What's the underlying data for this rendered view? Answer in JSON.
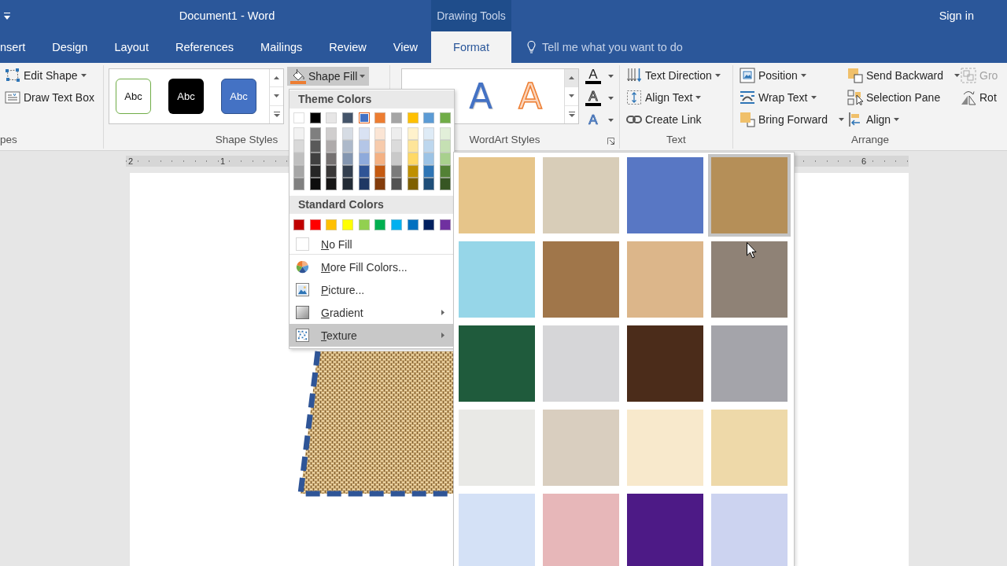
{
  "title_bar": {
    "title": "Document1 - Word",
    "context_header": "Drawing Tools",
    "sign_in": "Sign in"
  },
  "tabs": [
    {
      "label": "nsert",
      "contextual": false,
      "selected": false
    },
    {
      "label": "Design",
      "contextual": false,
      "selected": false
    },
    {
      "label": "Layout",
      "contextual": false,
      "selected": false
    },
    {
      "label": "References",
      "contextual": false,
      "selected": false
    },
    {
      "label": "Mailings",
      "contextual": false,
      "selected": false
    },
    {
      "label": "Review",
      "contextual": false,
      "selected": false
    },
    {
      "label": "View",
      "contextual": false,
      "selected": false
    },
    {
      "label": "Format",
      "contextual": true,
      "selected": true
    }
  ],
  "tell_me": {
    "placeholder": "Tell me what you want to do"
  },
  "ribbon": {
    "insert_shapes": {
      "label": "pes",
      "commands": [
        {
          "kind": "edit-shape",
          "label": "Edit Shape",
          "dropdown": true
        },
        {
          "kind": "text-box",
          "label": "Draw Text Box",
          "dropdown": false
        }
      ]
    },
    "shape_styles": {
      "label": "Shape Styles",
      "styles": [
        {
          "kind": "outline",
          "label": "Abc"
        },
        {
          "kind": "dark",
          "label": "Abc"
        },
        {
          "kind": "blue",
          "label": "Abc"
        }
      ],
      "fill_button": {
        "label": "Shape Fill",
        "expanded": true
      }
    },
    "wordart_styles": {
      "label": "WordArt Styles",
      "styles": [
        {
          "kind": "blue",
          "label": "A"
        },
        {
          "kind": "orange",
          "label": "A"
        }
      ],
      "text_tools": [
        {
          "kind": "fill",
          "glyph": "A"
        },
        {
          "kind": "outline",
          "glyph": "A"
        },
        {
          "kind": "effects",
          "glyph": "A"
        }
      ]
    },
    "text": {
      "label": "Text",
      "commands": [
        {
          "kind": "text-direction",
          "label": "Text Direction",
          "dropdown": true
        },
        {
          "kind": "align-text",
          "label": "Align Text",
          "dropdown": true
        },
        {
          "kind": "create-link",
          "label": "Create Link",
          "dropdown": false
        }
      ]
    },
    "arrange": {
      "label": "Arrange",
      "columns": [
        [
          {
            "kind": "position",
            "label": "Position",
            "dropdown": true,
            "split": false,
            "disabled": false
          },
          {
            "kind": "wrap-text",
            "label": "Wrap Text",
            "dropdown": true,
            "split": false,
            "disabled": false
          },
          {
            "kind": "bring-forward",
            "label": "Bring Forward",
            "dropdown": true,
            "split": true,
            "disabled": false
          }
        ],
        [
          {
            "kind": "send-backward",
            "label": "Send Backward",
            "dropdown": true,
            "split": true,
            "disabled": false
          },
          {
            "kind": "selection-pane",
            "label": "Selection Pane",
            "dropdown": false,
            "disabled": false
          },
          {
            "kind": "align",
            "label": "Align",
            "dropdown": true,
            "split": false,
            "disabled": false
          }
        ],
        [
          {
            "kind": "group",
            "label": "Gro",
            "dropdown": false,
            "disabled": true
          },
          {
            "kind": "rotate",
            "label": "Rot",
            "dropdown": false,
            "disabled": false
          }
        ]
      ]
    }
  },
  "ruler": {
    "labels": [
      "2",
      "1",
      "6"
    ]
  },
  "shape_fill_menu": {
    "theme_colors": {
      "title": "Theme Colors",
      "main": [
        {
          "color": "#ffffff",
          "selected": false
        },
        {
          "color": "#000000",
          "selected": false
        },
        {
          "color": "#e7e6e6",
          "selected": false
        },
        {
          "color": "#44546a",
          "selected": false
        },
        {
          "color": "#4472c4",
          "selected": true
        },
        {
          "color": "#ed7d31",
          "selected": false
        },
        {
          "color": "#a5a5a5",
          "selected": false
        },
        {
          "color": "#ffc000",
          "selected": false
        },
        {
          "color": "#5b9bd5",
          "selected": false
        },
        {
          "color": "#70ad47",
          "selected": false
        }
      ],
      "shades": [
        [
          {
            "color": "#f2f2f2",
            "selected": false
          },
          {
            "color": "#7f7f7f",
            "selected": false
          },
          {
            "color": "#d0cece",
            "selected": false
          },
          {
            "color": "#d6dce4",
            "selected": false
          },
          {
            "color": "#d9e2f3",
            "selected": false
          },
          {
            "color": "#fbe5d5",
            "selected": false
          },
          {
            "color": "#ededed",
            "selected": false
          },
          {
            "color": "#fff2cc",
            "selected": false
          },
          {
            "color": "#deebf6",
            "selected": false
          },
          {
            "color": "#e2efd9",
            "selected": false
          }
        ],
        [
          {
            "color": "#d9d9d9",
            "selected": false
          },
          {
            "color": "#595959",
            "selected": false
          },
          {
            "color": "#aeaaaa",
            "selected": false
          },
          {
            "color": "#adb9ca",
            "selected": false
          },
          {
            "color": "#b4c6e7",
            "selected": false
          },
          {
            "color": "#f7cbac",
            "selected": false
          },
          {
            "color": "#dbdbdb",
            "selected": false
          },
          {
            "color": "#fee599",
            "selected": false
          },
          {
            "color": "#bdd7ee",
            "selected": false
          },
          {
            "color": "#c5e0b3",
            "selected": false
          }
        ],
        [
          {
            "color": "#bfbfbf",
            "selected": false
          },
          {
            "color": "#404040",
            "selected": false
          },
          {
            "color": "#757171",
            "selected": false
          },
          {
            "color": "#8496b0",
            "selected": false
          },
          {
            "color": "#8eaadb",
            "selected": false
          },
          {
            "color": "#f4b183",
            "selected": false
          },
          {
            "color": "#c9c9c9",
            "selected": false
          },
          {
            "color": "#ffd965",
            "selected": false
          },
          {
            "color": "#9cc3e5",
            "selected": false
          },
          {
            "color": "#a8d08d",
            "selected": false
          }
        ],
        [
          {
            "color": "#a6a6a6",
            "selected": false
          },
          {
            "color": "#262626",
            "selected": false
          },
          {
            "color": "#3a3838",
            "selected": false
          },
          {
            "color": "#333f4f",
            "selected": false
          },
          {
            "color": "#2f5496",
            "selected": false
          },
          {
            "color": "#c55a11",
            "selected": false
          },
          {
            "color": "#7b7b7b",
            "selected": false
          },
          {
            "color": "#bf9000",
            "selected": false
          },
          {
            "color": "#2e75b5",
            "selected": false
          },
          {
            "color": "#538135",
            "selected": false
          }
        ],
        [
          {
            "color": "#808080",
            "selected": false
          },
          {
            "color": "#0d0d0d",
            "selected": false
          },
          {
            "color": "#171616",
            "selected": false
          },
          {
            "color": "#222a35",
            "selected": false
          },
          {
            "color": "#1f3864",
            "selected": false
          },
          {
            "color": "#833c0b",
            "selected": false
          },
          {
            "color": "#525252",
            "selected": false
          },
          {
            "color": "#7f6000",
            "selected": false
          },
          {
            "color": "#1e4e79",
            "selected": false
          },
          {
            "color": "#375623",
            "selected": false
          }
        ]
      ]
    },
    "standard_colors": {
      "title": "Standard Colors",
      "swatches": [
        {
          "color": "#c00000",
          "selected": false
        },
        {
          "color": "#ff0000",
          "selected": false
        },
        {
          "color": "#ffc000",
          "selected": false
        },
        {
          "color": "#ffff00",
          "selected": false
        },
        {
          "color": "#92d050",
          "selected": false
        },
        {
          "color": "#00b050",
          "selected": false
        },
        {
          "color": "#00b0f0",
          "selected": false
        },
        {
          "color": "#0070c0",
          "selected": false
        },
        {
          "color": "#002060",
          "selected": false
        },
        {
          "color": "#7030a0",
          "selected": false
        }
      ]
    },
    "items": [
      {
        "kind": "no-fill",
        "label": "No Fill",
        "submenu": false,
        "selected": false
      },
      {
        "kind": "more-colors",
        "label": "More Fill Colors...",
        "submenu": false,
        "selected": false
      },
      {
        "kind": "picture",
        "label": "Picture...",
        "submenu": false,
        "selected": false
      },
      {
        "kind": "gradient",
        "label": "Gradient",
        "submenu": true,
        "selected": false
      },
      {
        "kind": "texture",
        "label": "Texture",
        "submenu": true,
        "selected": true
      }
    ]
  },
  "texture_menu": {
    "textures": [
      {
        "color": "#e6c58a",
        "selected": false
      },
      {
        "color": "#d8cdb8",
        "selected": false
      },
      {
        "color": "#5877c4",
        "selected": false
      },
      {
        "color": "#b58f58",
        "selected": true
      },
      {
        "color": "#96d6e8",
        "selected": false
      },
      {
        "color": "#a0764a",
        "selected": false
      },
      {
        "color": "#dcb68a",
        "selected": false
      },
      {
        "color": "#8f8276",
        "selected": false
      },
      {
        "color": "#1f5b3c",
        "selected": false
      },
      {
        "color": "#d6d6d8",
        "selected": false
      },
      {
        "color": "#4b2c1a",
        "selected": false
      },
      {
        "color": "#a4a4aa",
        "selected": false
      },
      {
        "color": "#e9e9e6",
        "selected": false
      },
      {
        "color": "#d9cebf",
        "selected": false
      },
      {
        "color": "#f8e9cc",
        "selected": false
      },
      {
        "color": "#eed9a9",
        "selected": false
      },
      {
        "color": "#d4e1f6",
        "selected": false
      },
      {
        "color": "#e7b7b9",
        "selected": false
      },
      {
        "color": "#4d1a86",
        "selected": false
      },
      {
        "color": "#ccd3f0",
        "selected": false
      }
    ]
  }
}
